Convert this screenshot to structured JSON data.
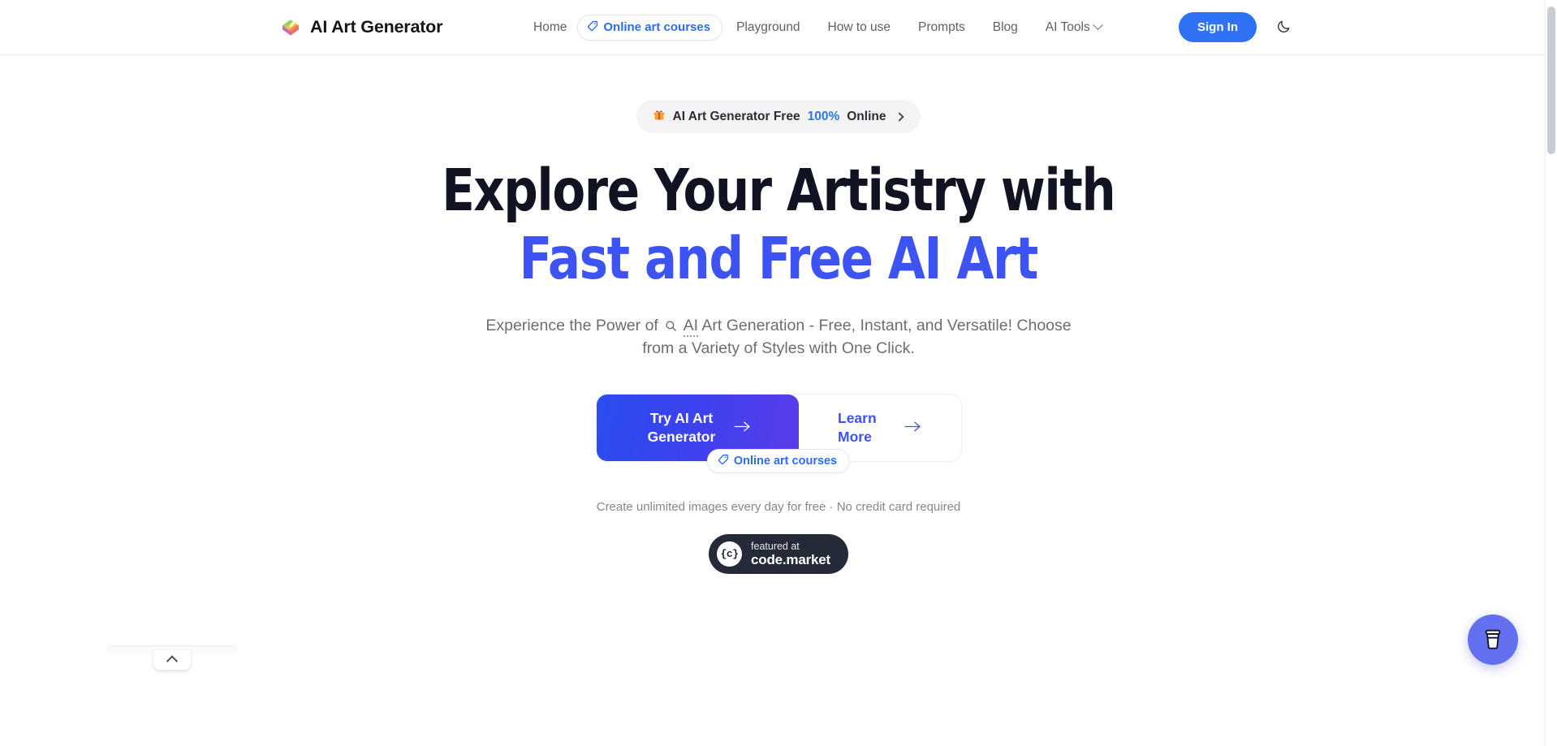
{
  "navbar": {
    "brand": {
      "logo_icon": "art-palette-icon",
      "title": "AI Art Generator"
    },
    "links": [
      {
        "label": "Home",
        "type": "text"
      },
      {
        "label": "Online art courses",
        "type": "pill",
        "icon": "tag-icon"
      },
      {
        "label": "Playground",
        "type": "text"
      },
      {
        "label": "How to use",
        "type": "text"
      },
      {
        "label": "Prompts",
        "type": "text"
      },
      {
        "label": "Blog",
        "type": "text"
      },
      {
        "label": "AI Tools",
        "type": "dropdown",
        "icon": "chevron-down-icon"
      }
    ],
    "sign_in_label": "Sign In",
    "theme_toggle_icon": "moon-icon"
  },
  "hero": {
    "promo": {
      "icon": "gift-icon",
      "text_before": "AI Art Generator Free",
      "highlight": "100%",
      "text_after": "Online",
      "arrow_icon": "chevron-right-icon"
    },
    "headline_line1": "Explore Your Artistry with",
    "headline_line2": "Fast and Free AI Art",
    "subtitle_part1": "Experience the Power of",
    "subtitle_icon": "search-icon",
    "subtitle_token": "AI",
    "subtitle_part2": "Art Generation - Free, Instant, and Versatile! Choose from a Variety of Styles with One Click.",
    "cta_primary": "Try AI Art Generator",
    "cta_primary_icon": "arrow-right-icon",
    "cta_secondary": "Learn More",
    "cta_secondary_icon": "arrow-right-icon",
    "courses_tag": "Online art courses",
    "courses_tag_icon": "tag-icon",
    "fineprint": "Create unlimited images every day for free · No credit card required",
    "featured_badge": {
      "logo_text": "{c}",
      "top": "featured at",
      "bottom": "code.market"
    }
  },
  "floating": {
    "coffee_button_icon": "coffee-cup-icon"
  },
  "bottom_left_widget": {
    "expander_icon": "chevron-up-icon"
  },
  "colors": {
    "accent_blue": "#2f72f4",
    "headline_accent": "#3d53f4",
    "gradient_start": "#2b4ef0",
    "gradient_end": "#5a3cea",
    "badge_dark": "#242a38",
    "coffee_fab": "#6370f0",
    "text_dark": "#15161a",
    "text_muted": "#6c6e77"
  }
}
